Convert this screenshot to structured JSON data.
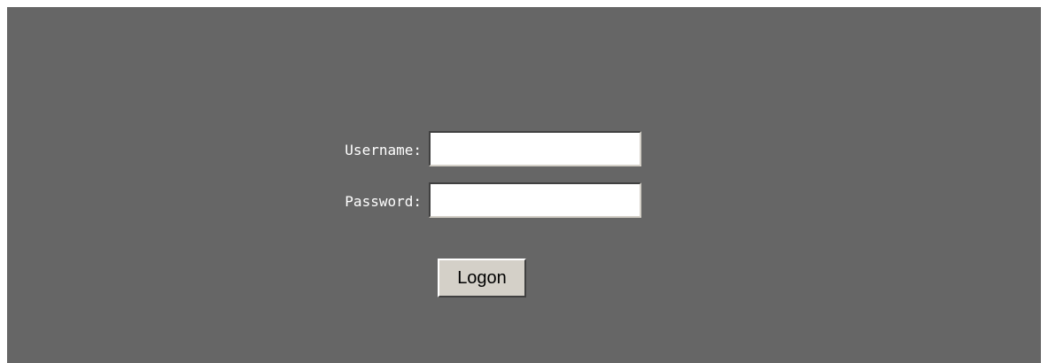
{
  "login_form": {
    "username_label": "Username:",
    "username_value": "",
    "password_label": "Password:",
    "password_value": "",
    "logon_button_label": "Logon"
  },
  "colors": {
    "panel_background": "#666666",
    "label_text": "#ffffff",
    "button_face": "#d4d0c8"
  }
}
